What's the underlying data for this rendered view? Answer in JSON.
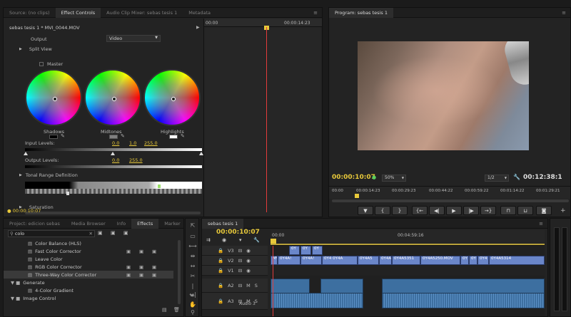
{
  "effect_controls": {
    "tabs": [
      "Source: (no clips)",
      "Effect Controls",
      "Audio Clip Mixer: sebas tesis 1",
      "Metadata"
    ],
    "clip_path": "sebas tesis 1 * MVI_0044.MOV",
    "timeline_start": "00:00",
    "timeline_end": "00:00:14:23",
    "output_label": "Output",
    "output_value": "Video",
    "split_view": "Split View",
    "master_label": "Master",
    "wheels": {
      "shadows": "Shadows",
      "midtones": "Midtones",
      "highlights": "Highlights"
    },
    "input_levels_label": "Input Levels:",
    "input_levels": [
      "0.0",
      "1.0",
      "255.0"
    ],
    "output_levels_label": "Output Levels:",
    "output_levels": [
      "0.0",
      "255.0"
    ],
    "tonal_range": "Tonal Range Definition",
    "saturation": "Saturation",
    "timecode": "00:00:10:07"
  },
  "program": {
    "tab": "Program: sebas tesis 1",
    "timecode": "00:00:10:07",
    "zoom": "50%",
    "resolution": "1/2",
    "duration": "00:12:38:1",
    "ruler": [
      "00:00",
      "00:00:14:23",
      "00:00:29:23",
      "00:00:44:22",
      "00:00:59:22",
      "00:01:14:22",
      "00:01:29:21"
    ],
    "buttons": [
      "marker-icon",
      "in-icon",
      "out-icon",
      "go-to-in-icon",
      "step-back-icon",
      "play-icon",
      "step-forward-icon",
      "go-to-out-icon",
      "lift-icon",
      "extract-icon",
      "camera-icon",
      "add-icon"
    ]
  },
  "project": {
    "tabs": [
      "Project: edicion sebas",
      "Media Browser",
      "Info",
      "Effects",
      "Marker"
    ],
    "search_value": "colo",
    "effects": [
      {
        "name": "Color Balance (HLS)",
        "indent": 2,
        "badges": false,
        "selected": false
      },
      {
        "name": "Fast Color Corrector",
        "indent": 2,
        "badges": true,
        "selected": false
      },
      {
        "name": "Leave Color",
        "indent": 2,
        "badges": false,
        "selected": false
      },
      {
        "name": "RGB Color Corrector",
        "indent": 2,
        "badges": true,
        "selected": false
      },
      {
        "name": "Three-Way Color Corrector",
        "indent": 2,
        "badges": true,
        "selected": true
      },
      {
        "name": "Generate",
        "indent": 0,
        "badges": false,
        "selected": false,
        "folder": true
      },
      {
        "name": "4-Color Gradient",
        "indent": 2,
        "badges": false,
        "selected": false
      },
      {
        "name": "Image Control",
        "indent": 0,
        "badges": false,
        "selected": false,
        "folder": true
      }
    ]
  },
  "timeline": {
    "tab": "sebas tesis 1",
    "timecode": "00:00:10:07",
    "ruler_start": "00:00",
    "ruler_mid": "00:04:59:16",
    "tracks": [
      "V3",
      "V2",
      "V1",
      "A2",
      "A3"
    ],
    "audio_name": "Audio 3",
    "v2_clips": [
      "MV",
      "0Y4A!",
      "0Y4A!",
      "0Y4 0Y4A",
      "0Y4A5",
      "0Y4A",
      "0Y4A5351",
      "0Y4A5250.MOV",
      "0Y",
      "0Y",
      "0Y4",
      "0Y4A5314"
    ],
    "v3_clips": [
      "0Y",
      "0Y",
      "0Y"
    ]
  },
  "colors": {
    "accent": "#4f9ae8",
    "timecode": "#e8c93a",
    "playhead": "#e23c3c",
    "clip": "#6a86c9",
    "audio": "#3d6fa0"
  }
}
